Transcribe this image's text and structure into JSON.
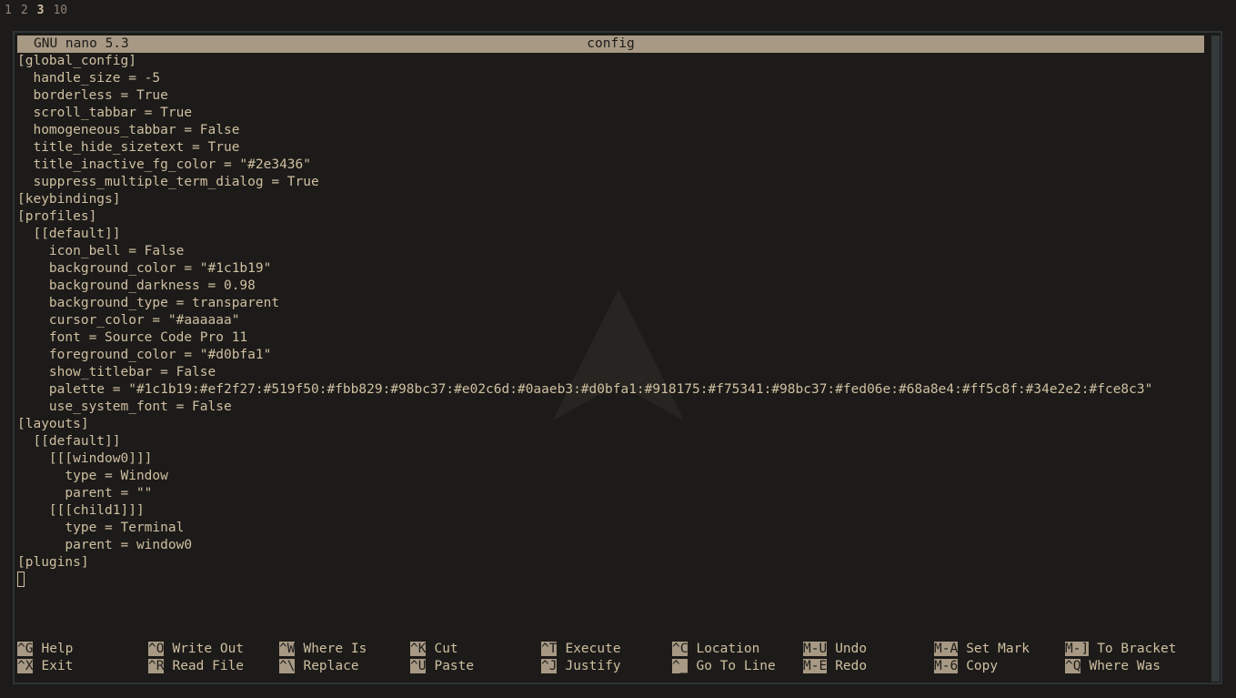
{
  "workspaces": [
    {
      "label": "1",
      "active": false
    },
    {
      "label": "2",
      "active": false
    },
    {
      "label": "3",
      "active": true
    },
    {
      "label": "10",
      "active": false
    }
  ],
  "titlebar": {
    "app": "GNU nano 5.3",
    "filename": "config"
  },
  "lines": [
    "[global_config]",
    "  handle_size = -5",
    "  borderless = True",
    "  scroll_tabbar = True",
    "  homogeneous_tabbar = False",
    "  title_hide_sizetext = True",
    "  title_inactive_fg_color = \"#2e3436\"",
    "  suppress_multiple_term_dialog = True",
    "[keybindings]",
    "[profiles]",
    "  [[default]]",
    "    icon_bell = False",
    "    background_color = \"#1c1b19\"",
    "    background_darkness = 0.98",
    "    background_type = transparent",
    "    cursor_color = \"#aaaaaa\"",
    "    font = Source Code Pro 11",
    "    foreground_color = \"#d0bfa1\"",
    "    show_titlebar = False",
    "    palette = \"#1c1b19:#ef2f27:#519f50:#fbb829:#98bc37:#e02c6d:#0aaeb3:#d0bfa1:#918175:#f75341:#98bc37:#fed06e:#68a8e4:#ff5c8f:#34e2e2:#fce8c3\"",
    "    use_system_font = False",
    "[layouts]",
    "  [[default]]",
    "    [[[window0]]]",
    "      type = Window",
    "      parent = \"\"",
    "    [[[child1]]]",
    "      type = Terminal",
    "      parent = window0",
    "[plugins]"
  ],
  "shortcuts_row1": [
    {
      "key": "^G",
      "label": "Help"
    },
    {
      "key": "^O",
      "label": "Write Out"
    },
    {
      "key": "^W",
      "label": "Where Is"
    },
    {
      "key": "^K",
      "label": "Cut"
    },
    {
      "key": "^T",
      "label": "Execute"
    },
    {
      "key": "^C",
      "label": "Location"
    },
    {
      "key": "M-U",
      "label": "Undo"
    },
    {
      "key": "M-A",
      "label": "Set Mark"
    },
    {
      "key": "M-]",
      "label": "To Bracket"
    }
  ],
  "shortcuts_row2": [
    {
      "key": "^X",
      "label": "Exit"
    },
    {
      "key": "^R",
      "label": "Read File"
    },
    {
      "key": "^\\",
      "label": "Replace"
    },
    {
      "key": "^U",
      "label": "Paste"
    },
    {
      "key": "^J",
      "label": "Justify"
    },
    {
      "key": "^_",
      "label": "Go To Line"
    },
    {
      "key": "M-E",
      "label": "Redo"
    },
    {
      "key": "M-6",
      "label": "Copy"
    },
    {
      "key": "^Q",
      "label": "Where Was"
    }
  ],
  "colors": {
    "background": "#1c1b19",
    "foreground": "#d0bfa1",
    "titlebar_bg": "#a89984",
    "scrollbar": "#34393b"
  }
}
